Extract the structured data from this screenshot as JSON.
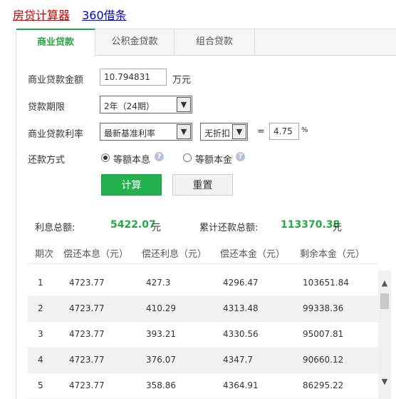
{
  "links": {
    "house_calc": "房贷计算器",
    "borrow": "360借条"
  },
  "tabs": [
    {
      "label": "商业贷款"
    },
    {
      "label": "公积金贷款"
    },
    {
      "label": "组合贷款"
    }
  ],
  "form": {
    "amount_label": "商业贷款金额",
    "amount_value": "10.794831",
    "amount_unit": "万元",
    "term_label": "贷款期限",
    "term_value": "2年（24期）",
    "rate_label": "商业贷款利率",
    "rate_type": "最新基准利率",
    "discount": "无折扣",
    "equals": "=",
    "rate_value": "4.75",
    "rate_unit": "%",
    "method_label": "还款方式",
    "method_1": "等额本息",
    "method_2": "等额本金",
    "selected_method": "等额本息"
  },
  "buttons": {
    "calculate": "计算",
    "reset": "重置"
  },
  "summary": {
    "interest_label": "利息总额:",
    "interest_value": "5422.07",
    "interest_unit": "元",
    "total_label": "累计还款总额:",
    "total_value": "113370.38",
    "total_unit": "元"
  },
  "table": {
    "headers": [
      "期次",
      "偿还本息（元）",
      "偿还利息（元）",
      "偿还本金（元）",
      "剩余本金（元）"
    ],
    "rows": [
      [
        "1",
        "4723.77",
        "427.3",
        "4296.47",
        "103651.84"
      ],
      [
        "2",
        "4723.77",
        "410.29",
        "4313.48",
        "99338.36"
      ],
      [
        "3",
        "4723.77",
        "393.21",
        "4330.56",
        "95007.81"
      ],
      [
        "4",
        "4723.77",
        "376.07",
        "4347.7",
        "90660.12"
      ],
      [
        "5",
        "4723.77",
        "358.86",
        "4364.91",
        "86295.22"
      ]
    ]
  },
  "icons": {
    "help": "help-icon",
    "scroll_up": "chevron-up-icon",
    "scroll_down": "chevron-down-icon"
  },
  "colors": {
    "accent": "#27a645",
    "button": "#23b14d"
  }
}
